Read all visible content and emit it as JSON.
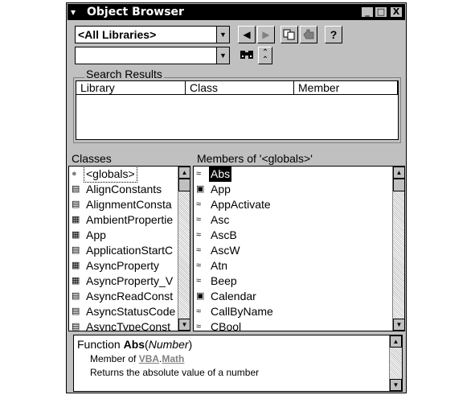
{
  "window": {
    "title": "Object Browser",
    "title_buttons": [
      "_",
      "□",
      "X"
    ]
  },
  "toolbar": {
    "library_combo_value": "<All Libraries>",
    "search_combo_value": "",
    "search_icon": "binoculars-icon",
    "toggle_icon": "double-chevron-up-icon",
    "nav_back_icon": "triangle-left-icon",
    "nav_forward_icon": "triangle-right-icon",
    "copy_icon": "copy-icon",
    "view_definition_icon": "hand-icon",
    "help_label": "?"
  },
  "search_results": {
    "title": "Search Results",
    "columns": [
      "Library",
      "Class",
      "Member"
    ]
  },
  "classes": {
    "title": "Classes",
    "items": [
      {
        "label": "<globals>",
        "icon": "globals-icon"
      },
      {
        "label": "AlignConstants",
        "icon": "enum-icon"
      },
      {
        "label": "AlignmentConsta",
        "icon": "enum-icon"
      },
      {
        "label": "AmbientPropertie",
        "icon": "class-icon"
      },
      {
        "label": "App",
        "icon": "class-icon"
      },
      {
        "label": "ApplicationStartC",
        "icon": "enum-icon"
      },
      {
        "label": "AsyncProperty",
        "icon": "class-icon"
      },
      {
        "label": "AsyncProperty_V",
        "icon": "class-icon"
      },
      {
        "label": "AsyncReadConst",
        "icon": "enum-icon"
      },
      {
        "label": "AsyncStatusCode",
        "icon": "enum-icon"
      },
      {
        "label": "AsyncTypeConst",
        "icon": "enum-icon"
      }
    ]
  },
  "members": {
    "title": "Members of '<globals>'",
    "items": [
      {
        "label": "Abs",
        "icon": "method-icon"
      },
      {
        "label": "App",
        "icon": "property-icon"
      },
      {
        "label": "AppActivate",
        "icon": "method-icon"
      },
      {
        "label": "Asc",
        "icon": "method-icon"
      },
      {
        "label": "AscB",
        "icon": "method-icon"
      },
      {
        "label": "AscW",
        "icon": "method-icon"
      },
      {
        "label": "Atn",
        "icon": "method-icon"
      },
      {
        "label": "Beep",
        "icon": "method-icon"
      },
      {
        "label": "Calendar",
        "icon": "property-icon"
      },
      {
        "label": "CallByName",
        "icon": "method-icon"
      },
      {
        "label": "CBool",
        "icon": "method-icon"
      }
    ]
  },
  "details": {
    "prefix": "Function ",
    "name": "Abs",
    "open_paren": "(",
    "param": "Number",
    "close_paren": ")",
    "member_of": "Member of ",
    "library_link": "VBA",
    "dot": ".",
    "module_link": "Math",
    "description": "Returns the absolute value of a number"
  },
  "colors": {
    "window_bg": "#c0c0c0",
    "titlebar_bg": "#000000",
    "selection_bg": "#000000",
    "link": "#808080"
  }
}
